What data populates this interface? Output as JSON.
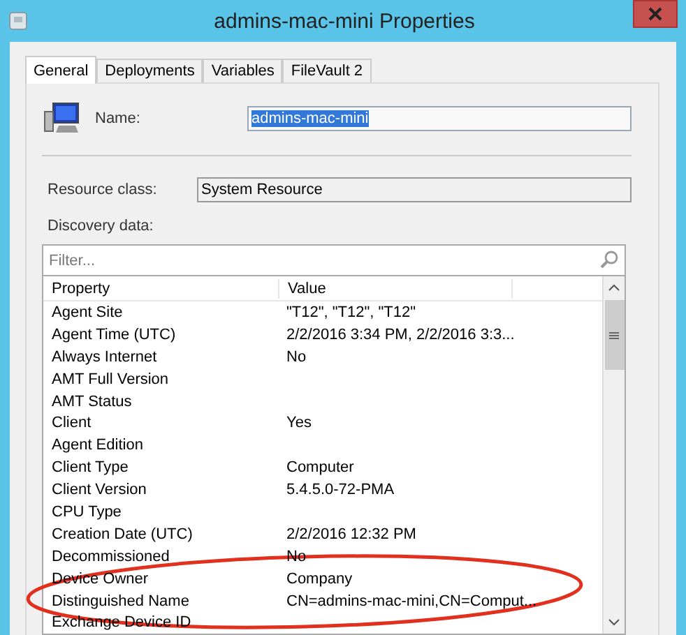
{
  "window": {
    "title": "admins-mac-mini Properties"
  },
  "tabs": [
    {
      "label": "General",
      "selected": true
    },
    {
      "label": "Deployments",
      "selected": false
    },
    {
      "label": "Variables",
      "selected": false
    },
    {
      "label": "FileVault 2",
      "selected": false
    }
  ],
  "name_field": {
    "label": "Name:",
    "value": "admins-mac-mini",
    "selected": true
  },
  "resource_class": {
    "label": "Resource class:",
    "value": "System Resource"
  },
  "discovery": {
    "label": "Discovery data:",
    "filter": {
      "placeholder": "Filter..."
    },
    "columns": [
      "Property",
      "Value"
    ],
    "rows": [
      {
        "property": "Agent Site",
        "value": "\"T12\", \"T12\", \"T12\""
      },
      {
        "property": "Agent Time (UTC)",
        "value": "2/2/2016 3:34 PM, 2/2/2016 3:3..."
      },
      {
        "property": "Always Internet",
        "value": "No"
      },
      {
        "property": "AMT Full Version"
      },
      {
        "property": "AMT Status"
      },
      {
        "property": "Client",
        "value": "Yes"
      },
      {
        "property": "Agent Edition"
      },
      {
        "property": "Client Type",
        "value": "Computer"
      },
      {
        "property": "Client Version",
        "value": "5.4.5.0-72-PMA"
      },
      {
        "property": "CPU Type"
      },
      {
        "property": "Creation Date (UTC)",
        "value": "2/2/2016 12:32 PM"
      },
      {
        "property": "Decommissioned",
        "value": "No"
      },
      {
        "property": "Device Owner",
        "value": "Company"
      },
      {
        "property": "Distinguished Name",
        "value": "CN=admins-mac-mini,CN=Comput..."
      },
      {
        "property": "Exchange Device ID"
      }
    ]
  }
}
